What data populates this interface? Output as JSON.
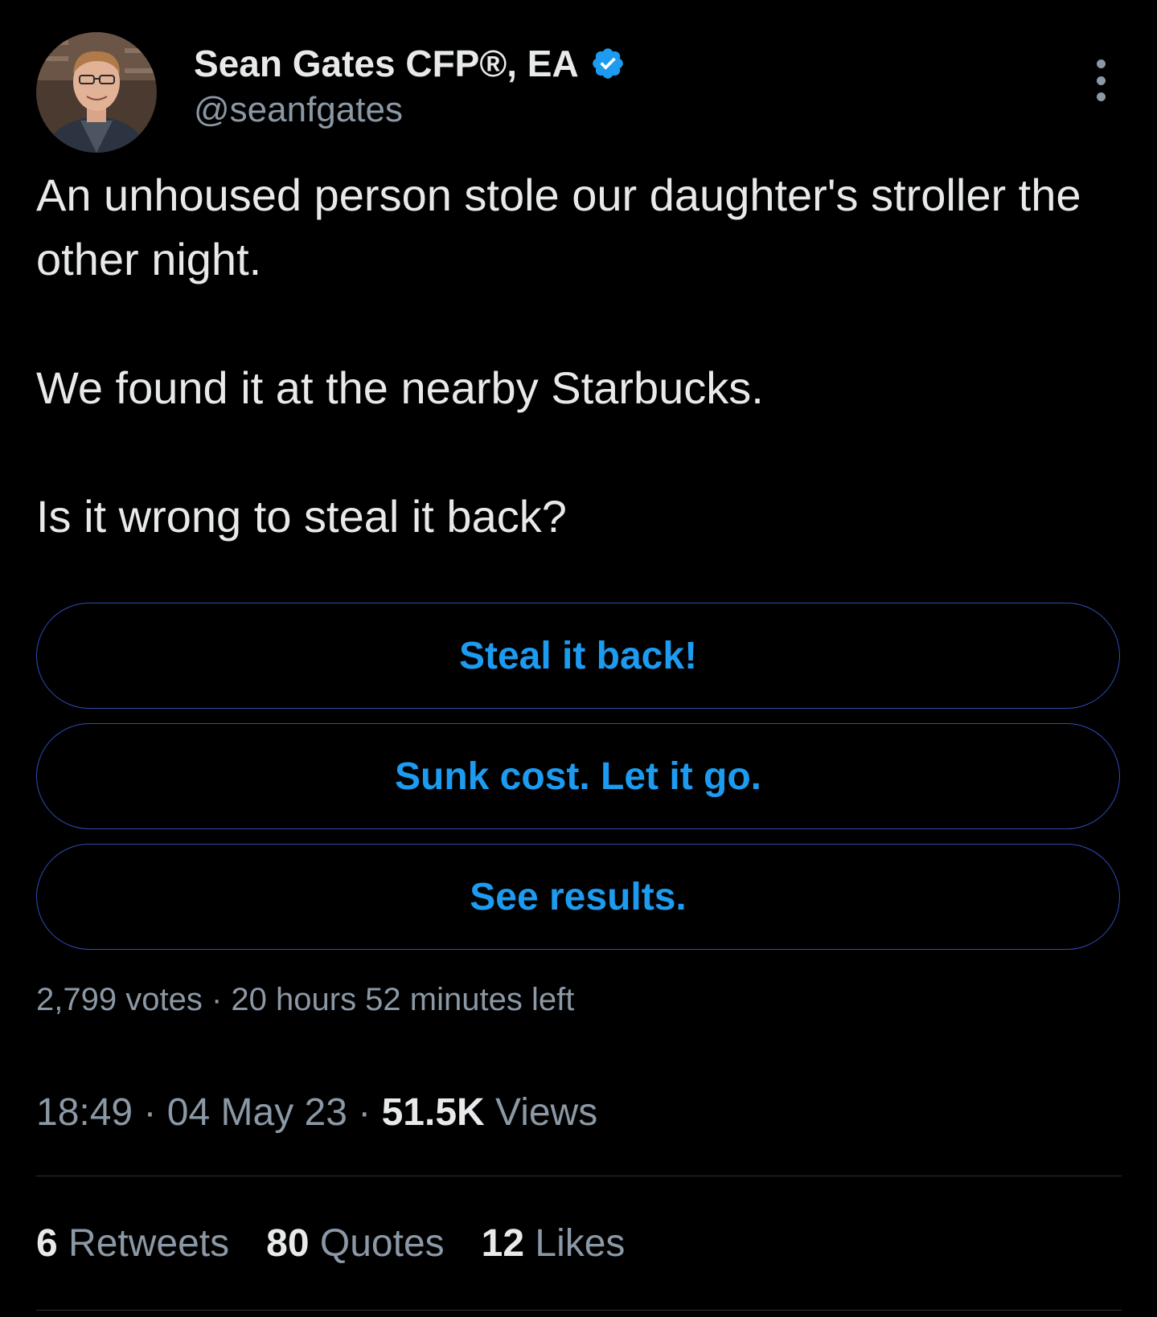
{
  "author": {
    "display_name": "Sean Gates CFP®, EA",
    "handle": "@seanfgates",
    "verified_icon": "verified-badge-icon",
    "verified_color": "#1d9bf0"
  },
  "tweet": {
    "text_line1": "An unhoused person stole our daughter's stroller the other night.",
    "text_line2": "We found it at the nearby Starbucks.",
    "text_line3": "Is it wrong to steal it back?"
  },
  "poll": {
    "options": [
      {
        "label": "Steal it back!"
      },
      {
        "label": "Sunk cost. Let it go."
      },
      {
        "label": "See results."
      }
    ],
    "votes": "2,799 votes",
    "separator": "·",
    "time_left": "20 hours 52 minutes left"
  },
  "meta": {
    "time": "18:49",
    "date": "04 May 23",
    "views_count": "51.5K",
    "views_label": "Views",
    "separator": "·"
  },
  "stats": [
    {
      "count": "6",
      "label": "Retweets"
    },
    {
      "count": "80",
      "label": "Quotes"
    },
    {
      "count": "12",
      "label": "Likes"
    }
  ],
  "colors": {
    "background": "#000000",
    "text_primary": "#e7e9ea",
    "text_secondary": "#8b98a5",
    "accent": "#1d9bf0",
    "poll_border": "#2f4cb8"
  }
}
